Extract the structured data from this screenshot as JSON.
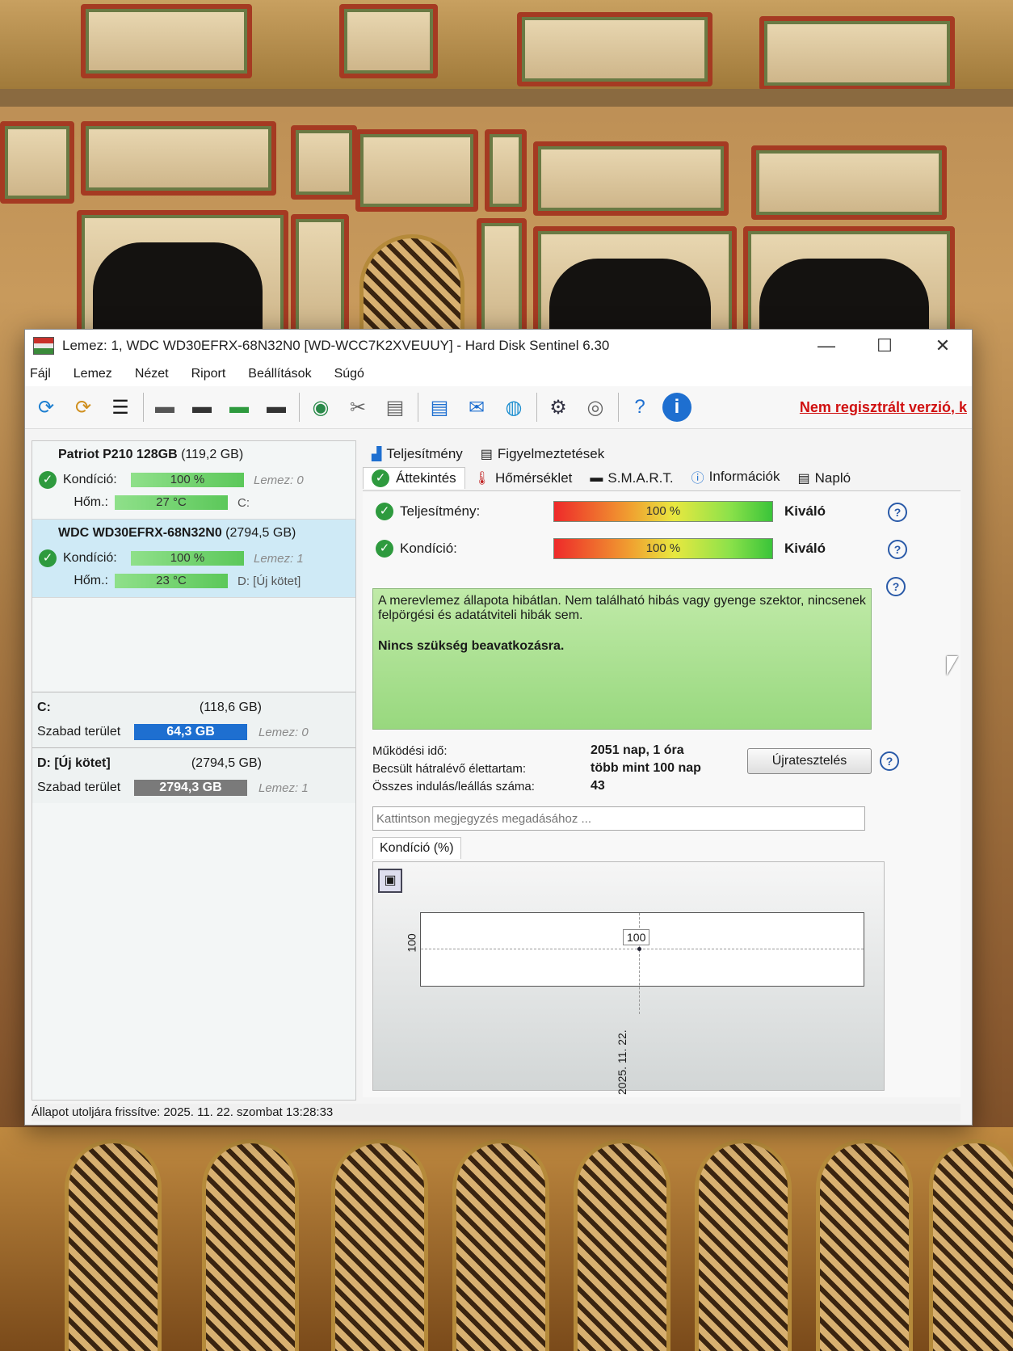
{
  "window": {
    "title": "Lemez: 1, WDC WD30EFRX-68N32N0 [WD-WCC7K2XVEUUY]  -  Hard Disk Sentinel 6.30",
    "controls": {
      "minimize": "—",
      "maximize": "☐",
      "close": "✕"
    }
  },
  "menu": [
    "Fájl",
    "Lemez",
    "Nézet",
    "Riport",
    "Beállítások",
    "Súgó"
  ],
  "toolbar": {
    "icons": [
      "refresh-icon",
      "refresh-alert-icon",
      "disk-list-icon",
      "disk-surface-icon",
      "disk-schedule-icon",
      "disk-ok-icon",
      "disk-search-icon",
      "globe-disk-icon",
      "tools-icon",
      "backup-icon",
      "report-icon",
      "email-icon",
      "network-icon",
      "settings-gear-icon",
      "sound-icon",
      "help-icon",
      "info-icon"
    ],
    "unregistered": "Nem regisztrált verzió, k"
  },
  "disks": [
    {
      "name": "Patriot P210 128GB",
      "size": "(119,2 GB)",
      "condition_label": "Kondíció:",
      "condition": "100 %",
      "temp_label": "Hőm.:",
      "temp": "27 °C",
      "disk_ref": "Lemez: 0",
      "drive": "C:",
      "selected": false
    },
    {
      "name": "WDC WD30EFRX-68N32N0",
      "size": "(2794,5 GB)",
      "condition_label": "Kondíció:",
      "condition": "100 %",
      "temp_label": "Hőm.:",
      "temp": "23 °C",
      "disk_ref": "Lemez: 1",
      "drive": "D: [Új kötet]",
      "selected": true
    }
  ],
  "volumes": [
    {
      "name": "C:",
      "size": "(118,6 GB)",
      "free_label": "Szabad terület",
      "free": "64,3 GB",
      "disk_ref": "Lemez: 0",
      "bar_color": "#1e6fd0"
    },
    {
      "name": "D: [Új kötet]",
      "size": "(2794,5 GB)",
      "free_label": "Szabad terület",
      "free": "2794,3 GB",
      "disk_ref": "Lemez: 1",
      "bar_color": "#7a7a7a"
    }
  ],
  "tabs_top": [
    "Teljesítmény",
    "Figyelmeztetések"
  ],
  "tabs_main": [
    "Áttekintés",
    "Hőmérséklet",
    "S.M.A.R.T.",
    "Információk",
    "Napló"
  ],
  "overview": {
    "performance_label": "Teljesítmény:",
    "performance": "100 %",
    "performance_verdict": "Kiváló",
    "condition_label": "Kondíció:",
    "condition": "100 %",
    "condition_verdict": "Kiváló",
    "status_text": "A merevlemez állapota hibátlan. Nem található hibás vagy gyenge szektor, nincsenek felpörgési és adatátviteli hibák sem.",
    "status_action": "Nincs szükség beavatkozásra.",
    "uptime_label": "Működési idő:",
    "uptime": "2051 nap, 1 óra",
    "lifetime_label": "Becsült hátralévő élettartam:",
    "lifetime": "több mint 100 nap",
    "starts_label": "Összes indulás/leállás száma:",
    "starts": "43",
    "retest_button": "Újratesztelés",
    "note_placeholder": "Kattintson megjegyzés megadásához ...",
    "graph_tab": "Kondíció  (%)"
  },
  "chart_data": {
    "type": "line",
    "x": [
      "2025. 11. 22."
    ],
    "series": [
      {
        "values": [
          100
        ]
      }
    ],
    "ylabel_tick": "100",
    "data_label": "100",
    "grid": true
  },
  "statusbar": "Állapot utoljára frissítve: 2025. 11. 22. szombat 13:28:33"
}
